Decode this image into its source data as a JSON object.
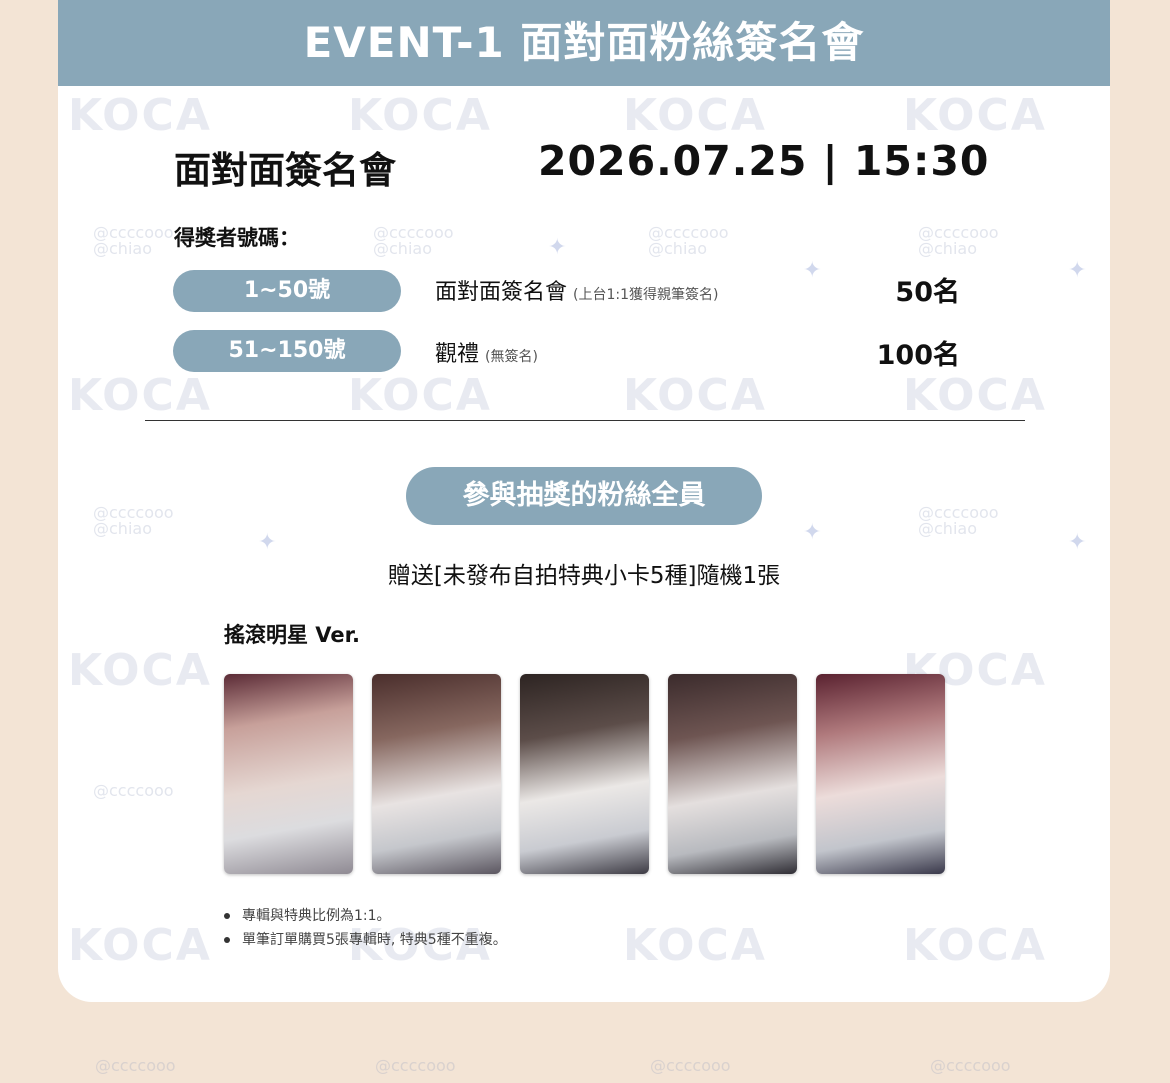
{
  "header": {
    "title": "EVENT-1 面對面粉絲簽名會"
  },
  "event": {
    "title": "面對面簽名會",
    "datetime": "2026.07.25 | 15:30"
  },
  "winners": {
    "label": "得獎者號碼：",
    "rows": [
      {
        "range": "1~50號",
        "desc": "面對面簽名會",
        "note": "(上台1:1獲得親筆簽名)",
        "count": "50名"
      },
      {
        "range": "51~150號",
        "desc": "觀禮",
        "note": "(無簽名)",
        "count": "100名"
      }
    ]
  },
  "all_participants": {
    "label": "參與抽獎的粉絲全員",
    "gift": "贈送[未發布自拍特典小卡5種]隨機1張"
  },
  "version_label": "搖滾明星 Ver.",
  "notes": [
    "專輯與特典比例為1:1。",
    "單筆訂單購買5張專輯時, 特典5種不重複。"
  ],
  "watermarks": {
    "logo": "KOCA",
    "handle1": "@ccccooo",
    "handle2": "@chiao"
  },
  "colors": {
    "accent": "#89a7b8",
    "background": "#f3e4d5"
  }
}
